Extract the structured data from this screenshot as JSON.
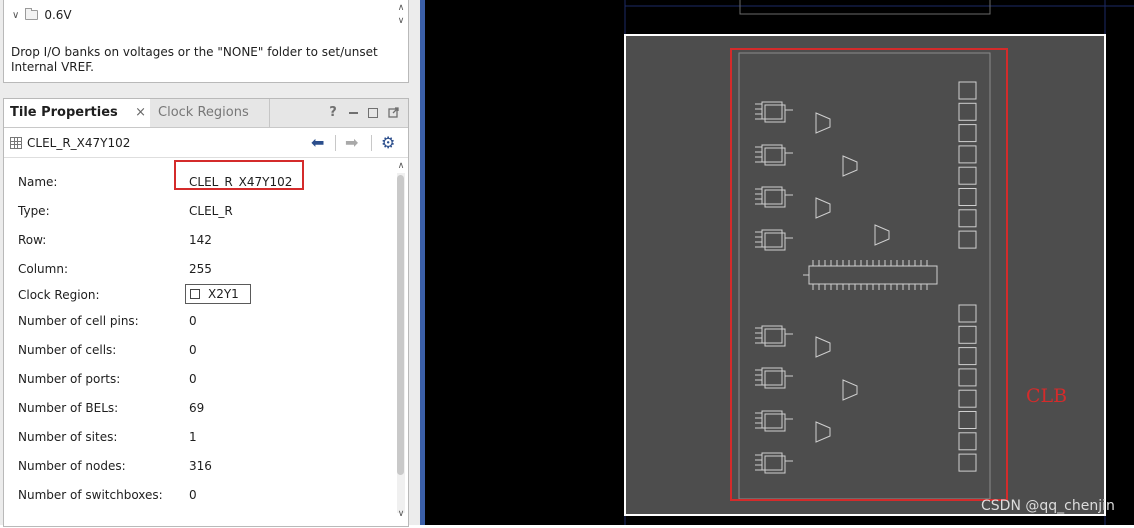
{
  "io_banks": {
    "voltage_label": "0.6V",
    "help_text": "Drop I/O banks on voltages or the \"NONE\" folder to set/unset Internal VREF."
  },
  "tabs": {
    "active_label": "Tile Properties",
    "close_symbol": "×",
    "inactive_label": "Clock Regions"
  },
  "window_controls": {
    "help": "?"
  },
  "object": {
    "name": "CLEL_R_X47Y102",
    "back_symbol": "⬅",
    "forward_symbol": "➡",
    "settings_symbol": "⚙"
  },
  "properties": [
    {
      "key": "Name:",
      "value": "CLEL_R_X47Y102"
    },
    {
      "key": "Type:",
      "value": "CLEL_R"
    },
    {
      "key": "Row:",
      "value": "142"
    },
    {
      "key": "Column:",
      "value": "255"
    },
    {
      "key": "Clock Region:",
      "value": "X2Y1"
    },
    {
      "key": "Number of cell pins:",
      "value": "0"
    },
    {
      "key": "Number of cells:",
      "value": "0"
    },
    {
      "key": "Number of ports:",
      "value": "0"
    },
    {
      "key": "Number of BELs:",
      "value": "69"
    },
    {
      "key": "Number of sites:",
      "value": "1"
    },
    {
      "key": "Number of nodes:",
      "value": "316"
    },
    {
      "key": "Number of switchboxes:",
      "value": "0"
    }
  ],
  "device_view": {
    "annotation": "CLB",
    "watermark": "CSDN @qq_chenjin"
  },
  "colors": {
    "highlight_red": "#d42b2b",
    "tile_fill": "#4d4d4d",
    "device_background": "#000000",
    "divider_blue": "#3b5fa8"
  },
  "icons": {
    "expand": "chevron-down-icon",
    "folder": "folder-icon",
    "tile": "grid-icon",
    "clock_region": "clock-region-icon",
    "back": "arrow-left-icon",
    "forward": "arrow-right-icon",
    "settings": "gear-icon",
    "minimize": "minimize-icon",
    "maximize": "maximize-icon",
    "float": "float-icon"
  }
}
